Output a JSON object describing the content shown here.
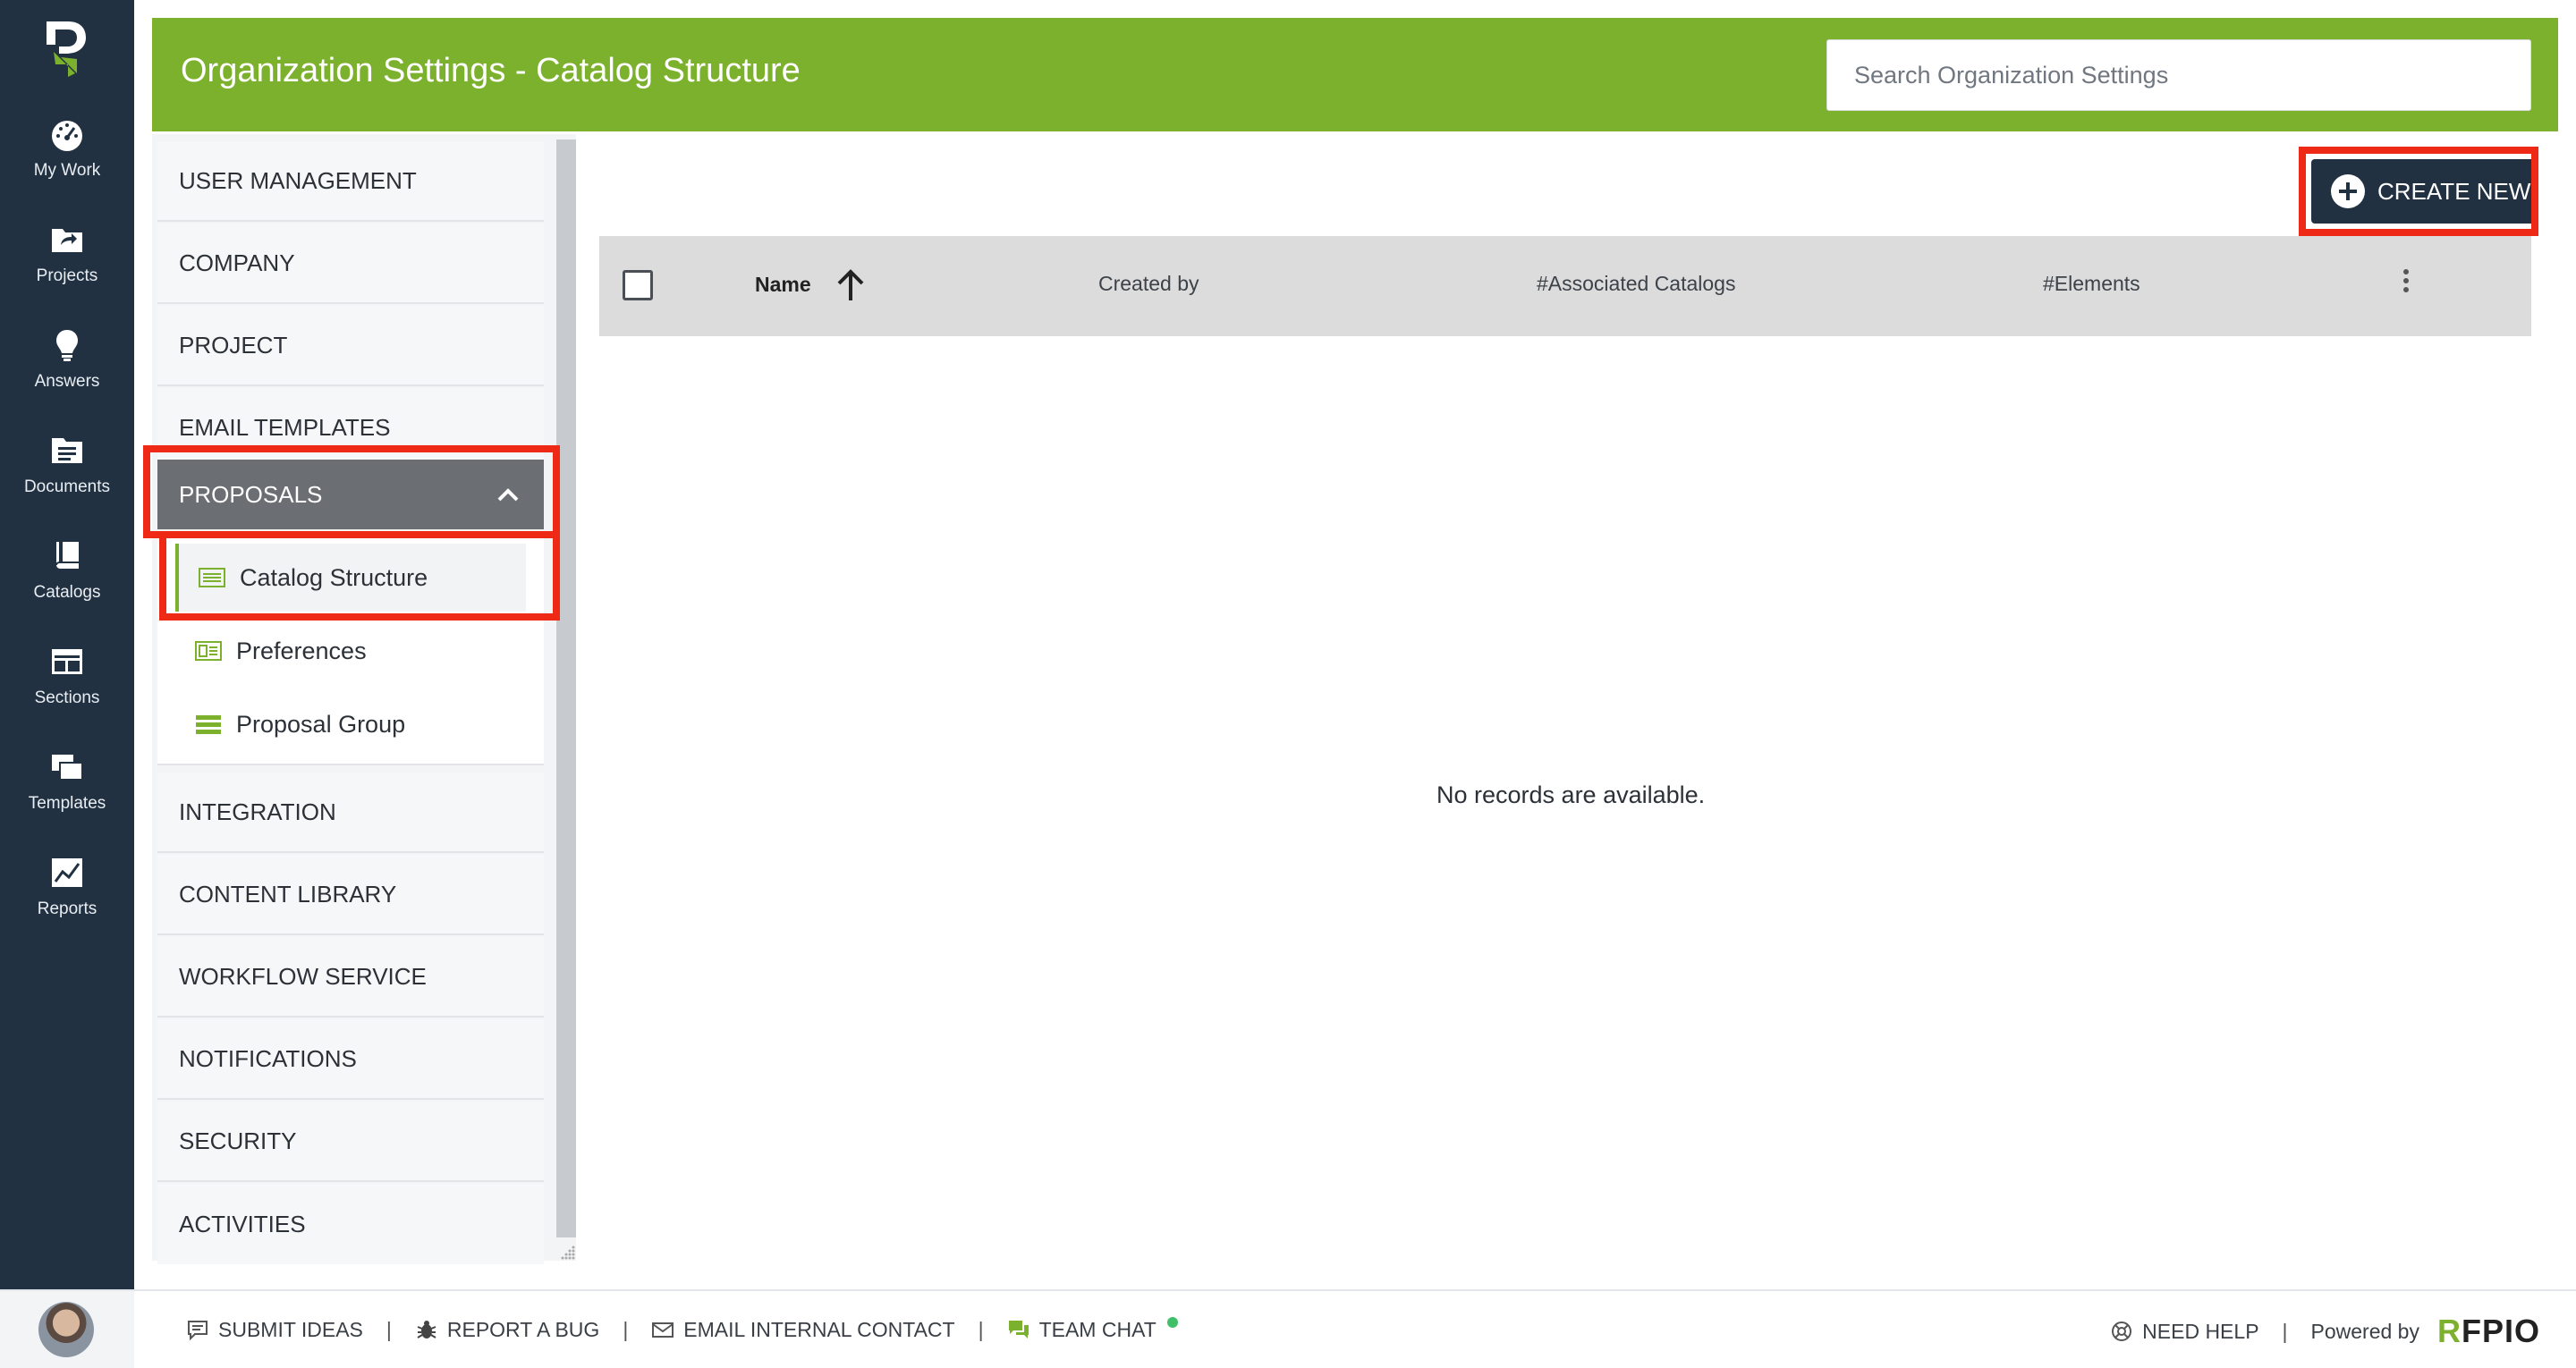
{
  "rail": {
    "items": [
      {
        "label": "My Work",
        "icon": "gauge-icon"
      },
      {
        "label": "Projects",
        "icon": "projects-folder-icon"
      },
      {
        "label": "Answers",
        "icon": "lightbulb-icon"
      },
      {
        "label": "Documents",
        "icon": "documents-icon"
      },
      {
        "label": "Catalogs",
        "icon": "catalogs-icon"
      },
      {
        "label": "Sections",
        "icon": "sections-icon"
      },
      {
        "label": "Templates",
        "icon": "templates-icon"
      },
      {
        "label": "Reports",
        "icon": "reports-icon"
      }
    ]
  },
  "header": {
    "title": "Organization Settings - Catalog Structure",
    "search_placeholder": "Search Organization Settings"
  },
  "nav": {
    "items": [
      "USER MANAGEMENT",
      "COMPANY",
      "PROJECT",
      "EMAIL TEMPLATES",
      "PROPOSALS",
      "INTEGRATION",
      "CONTENT LIBRARY",
      "WORKFLOW SERVICE",
      "NOTIFICATIONS",
      "SECURITY",
      "ACTIVITIES"
    ],
    "sub_items": [
      "Catalog Structure",
      "Preferences",
      "Proposal Group"
    ]
  },
  "main": {
    "create_label": "CREATE NEW",
    "columns": [
      "Name",
      "Created by",
      "#Associated Catalogs",
      "#Elements"
    ],
    "empty_text": "No records are available."
  },
  "footer": {
    "submit_ideas": "SUBMIT IDEAS",
    "report_bug": "REPORT A BUG",
    "email_contact": "EMAIL INTERNAL CONTACT",
    "team_chat": "TEAM CHAT",
    "need_help": "NEED HELP",
    "powered_by": "Powered by",
    "brand": "FPIO",
    "brand_mark": "R"
  },
  "colors": {
    "header_green": "#7bb12d",
    "rail_navy": "#213142",
    "highlight_red": "#ee2a17"
  }
}
